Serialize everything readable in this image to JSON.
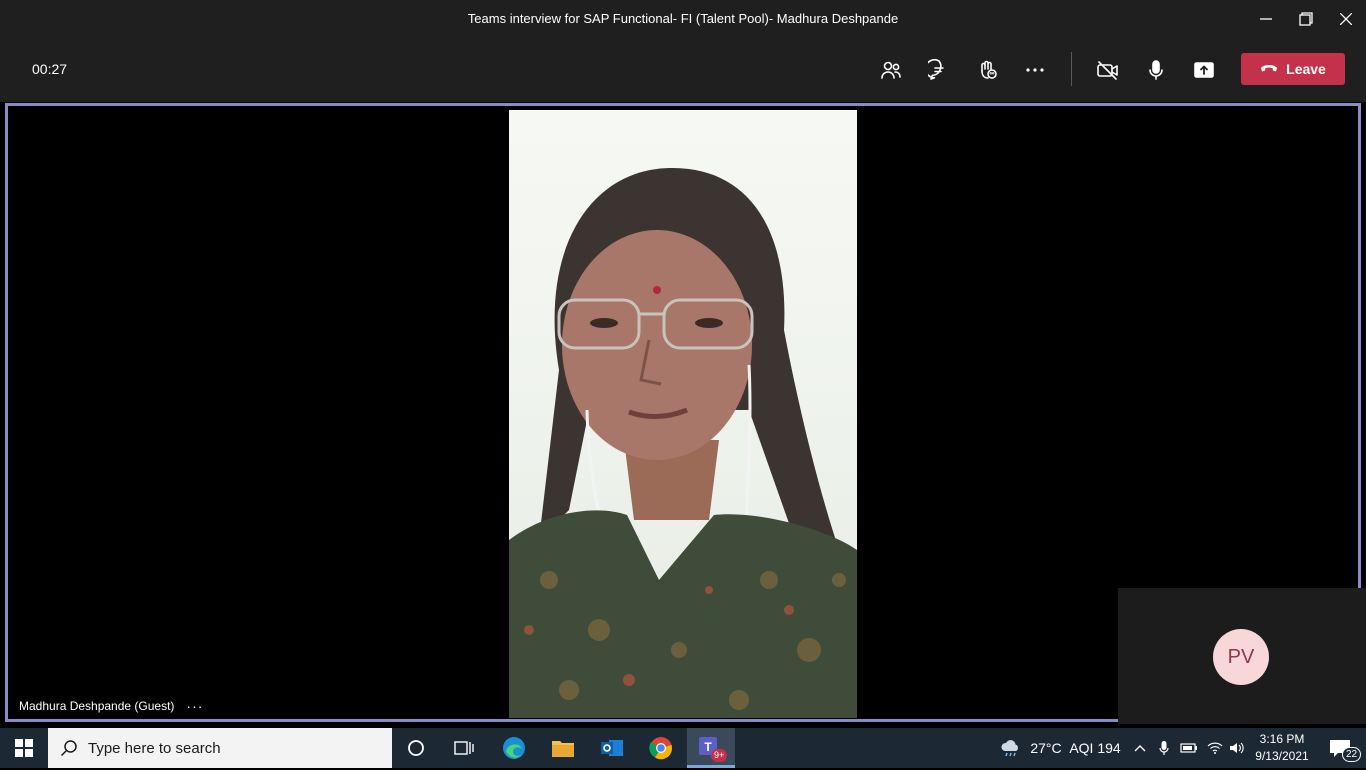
{
  "window": {
    "title": "Teams interview for SAP Functional- FI (Talent Pool)- Madhura Deshpande"
  },
  "toolbar": {
    "timer": "00:27",
    "buttons": [
      "people-icon",
      "chat-icon",
      "raise-hand-icon",
      "more-icon",
      "camera-off-icon",
      "microphone-icon",
      "share-screen-icon"
    ],
    "leave_label": "Leave",
    "leave_color": "#c4314b"
  },
  "stage": {
    "participant_name": "Madhura Deshpande (Guest)",
    "participant_more": "···",
    "border_color": "#8b8cc7",
    "self_avatar_initials": "PV"
  },
  "taskbar": {
    "search_placeholder": "Type here to search",
    "weather_temp": "27°C",
    "aqi": "AQI 194",
    "time": "3:16 PM",
    "date": "9/13/2021",
    "notification_count": "22",
    "teams_badge": "9+"
  }
}
